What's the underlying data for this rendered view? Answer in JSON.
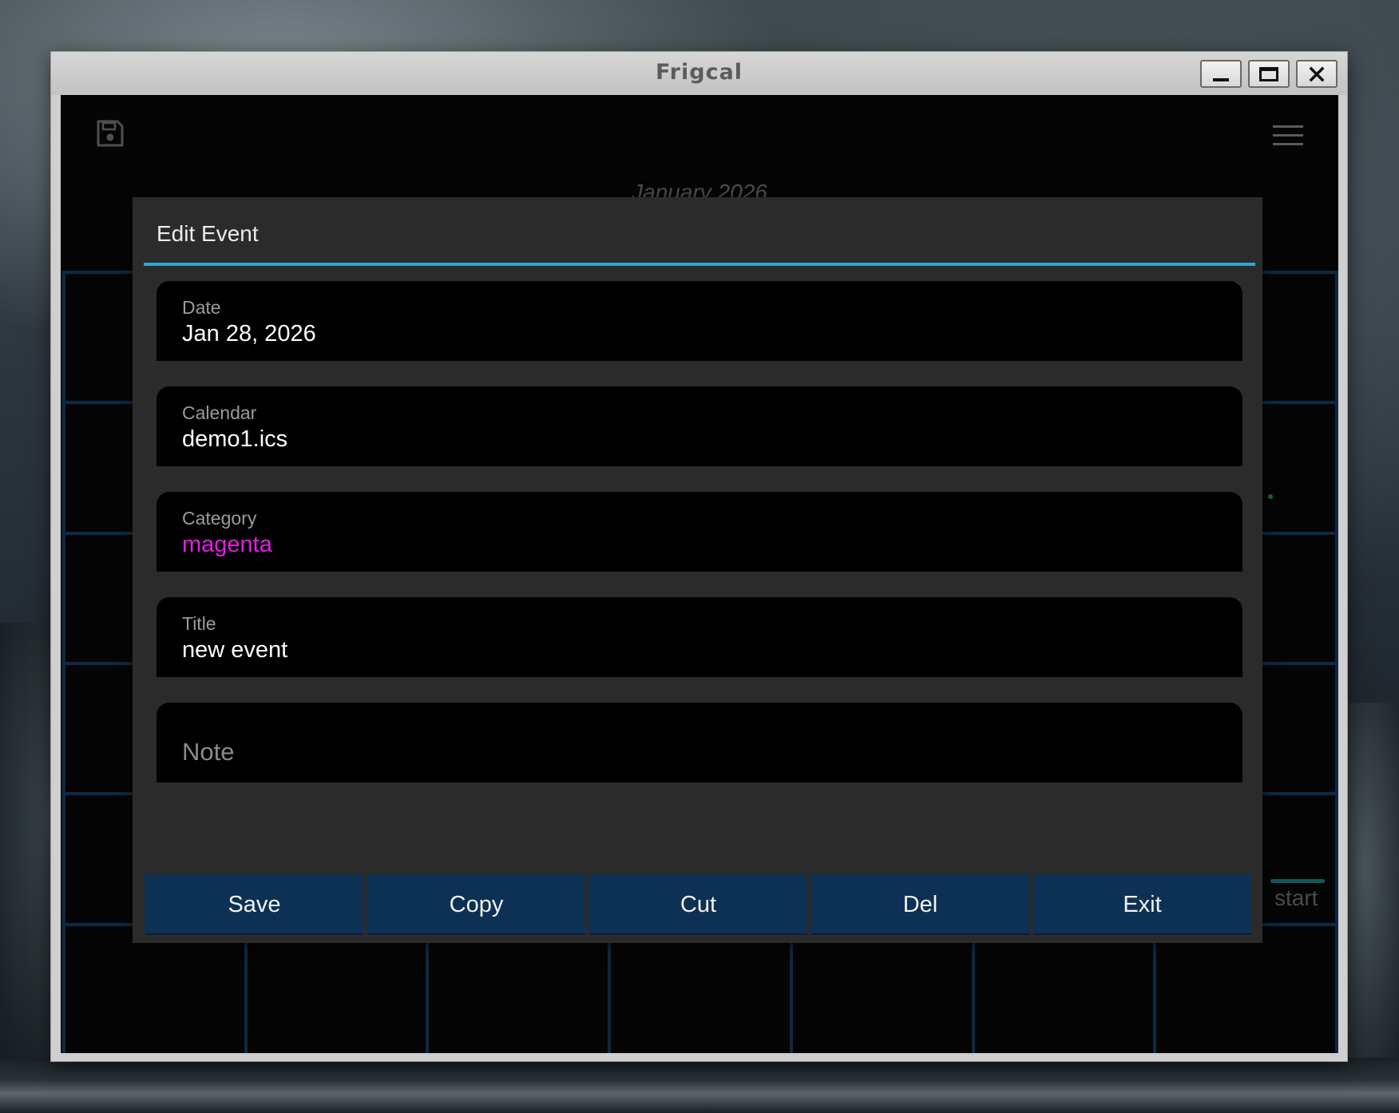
{
  "window": {
    "title": "Frigcal"
  },
  "calendar": {
    "month_title": "January 2026",
    "partial_label": "start"
  },
  "dialog": {
    "title": "Edit Event",
    "fields": {
      "date": {
        "label": "Date",
        "value": "Jan 28, 2026"
      },
      "calendar": {
        "label": "Calendar",
        "value": "demo1.ics"
      },
      "category": {
        "label": "Category",
        "value": "magenta",
        "color": "#e61ce6"
      },
      "title": {
        "label": "Title",
        "value": "new event"
      },
      "note": {
        "placeholder": "Note"
      }
    },
    "buttons": {
      "save": "Save",
      "copy": "Copy",
      "cut": "Cut",
      "del": "Del",
      "exit": "Exit"
    }
  },
  "colors": {
    "accent_rule": "#33a4d6",
    "button_bg": "#0c3154",
    "grid_line": "#0d2a45"
  },
  "icons": {
    "toolbar_left": "save-icon",
    "toolbar_right": "menu-icon"
  }
}
